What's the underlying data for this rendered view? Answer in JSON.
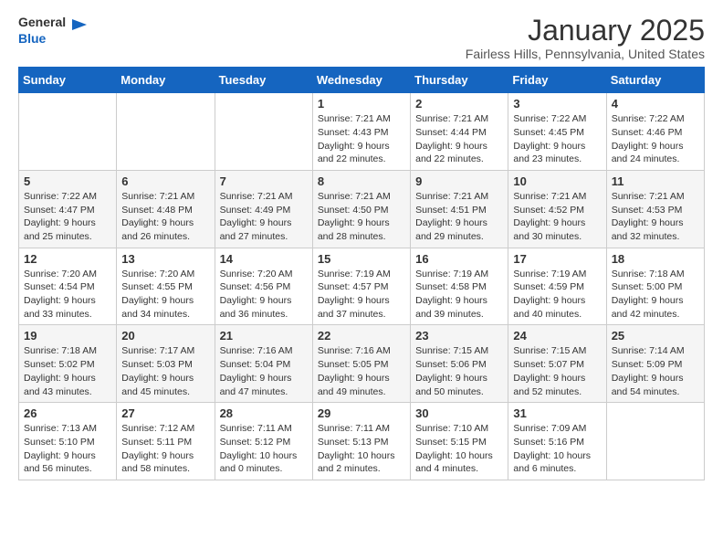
{
  "header": {
    "logo_general": "General",
    "logo_blue": "Blue",
    "month_title": "January 2025",
    "subtitle": "Fairless Hills, Pennsylvania, United States"
  },
  "weekdays": [
    "Sunday",
    "Monday",
    "Tuesday",
    "Wednesday",
    "Thursday",
    "Friday",
    "Saturday"
  ],
  "weeks": [
    [
      {
        "day": "",
        "info": ""
      },
      {
        "day": "",
        "info": ""
      },
      {
        "day": "",
        "info": ""
      },
      {
        "day": "1",
        "info": "Sunrise: 7:21 AM\nSunset: 4:43 PM\nDaylight: 9 hours\nand 22 minutes."
      },
      {
        "day": "2",
        "info": "Sunrise: 7:21 AM\nSunset: 4:44 PM\nDaylight: 9 hours\nand 22 minutes."
      },
      {
        "day": "3",
        "info": "Sunrise: 7:22 AM\nSunset: 4:45 PM\nDaylight: 9 hours\nand 23 minutes."
      },
      {
        "day": "4",
        "info": "Sunrise: 7:22 AM\nSunset: 4:46 PM\nDaylight: 9 hours\nand 24 minutes."
      }
    ],
    [
      {
        "day": "5",
        "info": "Sunrise: 7:22 AM\nSunset: 4:47 PM\nDaylight: 9 hours\nand 25 minutes."
      },
      {
        "day": "6",
        "info": "Sunrise: 7:21 AM\nSunset: 4:48 PM\nDaylight: 9 hours\nand 26 minutes."
      },
      {
        "day": "7",
        "info": "Sunrise: 7:21 AM\nSunset: 4:49 PM\nDaylight: 9 hours\nand 27 minutes."
      },
      {
        "day": "8",
        "info": "Sunrise: 7:21 AM\nSunset: 4:50 PM\nDaylight: 9 hours\nand 28 minutes."
      },
      {
        "day": "9",
        "info": "Sunrise: 7:21 AM\nSunset: 4:51 PM\nDaylight: 9 hours\nand 29 minutes."
      },
      {
        "day": "10",
        "info": "Sunrise: 7:21 AM\nSunset: 4:52 PM\nDaylight: 9 hours\nand 30 minutes."
      },
      {
        "day": "11",
        "info": "Sunrise: 7:21 AM\nSunset: 4:53 PM\nDaylight: 9 hours\nand 32 minutes."
      }
    ],
    [
      {
        "day": "12",
        "info": "Sunrise: 7:20 AM\nSunset: 4:54 PM\nDaylight: 9 hours\nand 33 minutes."
      },
      {
        "day": "13",
        "info": "Sunrise: 7:20 AM\nSunset: 4:55 PM\nDaylight: 9 hours\nand 34 minutes."
      },
      {
        "day": "14",
        "info": "Sunrise: 7:20 AM\nSunset: 4:56 PM\nDaylight: 9 hours\nand 36 minutes."
      },
      {
        "day": "15",
        "info": "Sunrise: 7:19 AM\nSunset: 4:57 PM\nDaylight: 9 hours\nand 37 minutes."
      },
      {
        "day": "16",
        "info": "Sunrise: 7:19 AM\nSunset: 4:58 PM\nDaylight: 9 hours\nand 39 minutes."
      },
      {
        "day": "17",
        "info": "Sunrise: 7:19 AM\nSunset: 4:59 PM\nDaylight: 9 hours\nand 40 minutes."
      },
      {
        "day": "18",
        "info": "Sunrise: 7:18 AM\nSunset: 5:00 PM\nDaylight: 9 hours\nand 42 minutes."
      }
    ],
    [
      {
        "day": "19",
        "info": "Sunrise: 7:18 AM\nSunset: 5:02 PM\nDaylight: 9 hours\nand 43 minutes."
      },
      {
        "day": "20",
        "info": "Sunrise: 7:17 AM\nSunset: 5:03 PM\nDaylight: 9 hours\nand 45 minutes."
      },
      {
        "day": "21",
        "info": "Sunrise: 7:16 AM\nSunset: 5:04 PM\nDaylight: 9 hours\nand 47 minutes."
      },
      {
        "day": "22",
        "info": "Sunrise: 7:16 AM\nSunset: 5:05 PM\nDaylight: 9 hours\nand 49 minutes."
      },
      {
        "day": "23",
        "info": "Sunrise: 7:15 AM\nSunset: 5:06 PM\nDaylight: 9 hours\nand 50 minutes."
      },
      {
        "day": "24",
        "info": "Sunrise: 7:15 AM\nSunset: 5:07 PM\nDaylight: 9 hours\nand 52 minutes."
      },
      {
        "day": "25",
        "info": "Sunrise: 7:14 AM\nSunset: 5:09 PM\nDaylight: 9 hours\nand 54 minutes."
      }
    ],
    [
      {
        "day": "26",
        "info": "Sunrise: 7:13 AM\nSunset: 5:10 PM\nDaylight: 9 hours\nand 56 minutes."
      },
      {
        "day": "27",
        "info": "Sunrise: 7:12 AM\nSunset: 5:11 PM\nDaylight: 9 hours\nand 58 minutes."
      },
      {
        "day": "28",
        "info": "Sunrise: 7:11 AM\nSunset: 5:12 PM\nDaylight: 10 hours\nand 0 minutes."
      },
      {
        "day": "29",
        "info": "Sunrise: 7:11 AM\nSunset: 5:13 PM\nDaylight: 10 hours\nand 2 minutes."
      },
      {
        "day": "30",
        "info": "Sunrise: 7:10 AM\nSunset: 5:15 PM\nDaylight: 10 hours\nand 4 minutes."
      },
      {
        "day": "31",
        "info": "Sunrise: 7:09 AM\nSunset: 5:16 PM\nDaylight: 10 hours\nand 6 minutes."
      },
      {
        "day": "",
        "info": ""
      }
    ]
  ]
}
